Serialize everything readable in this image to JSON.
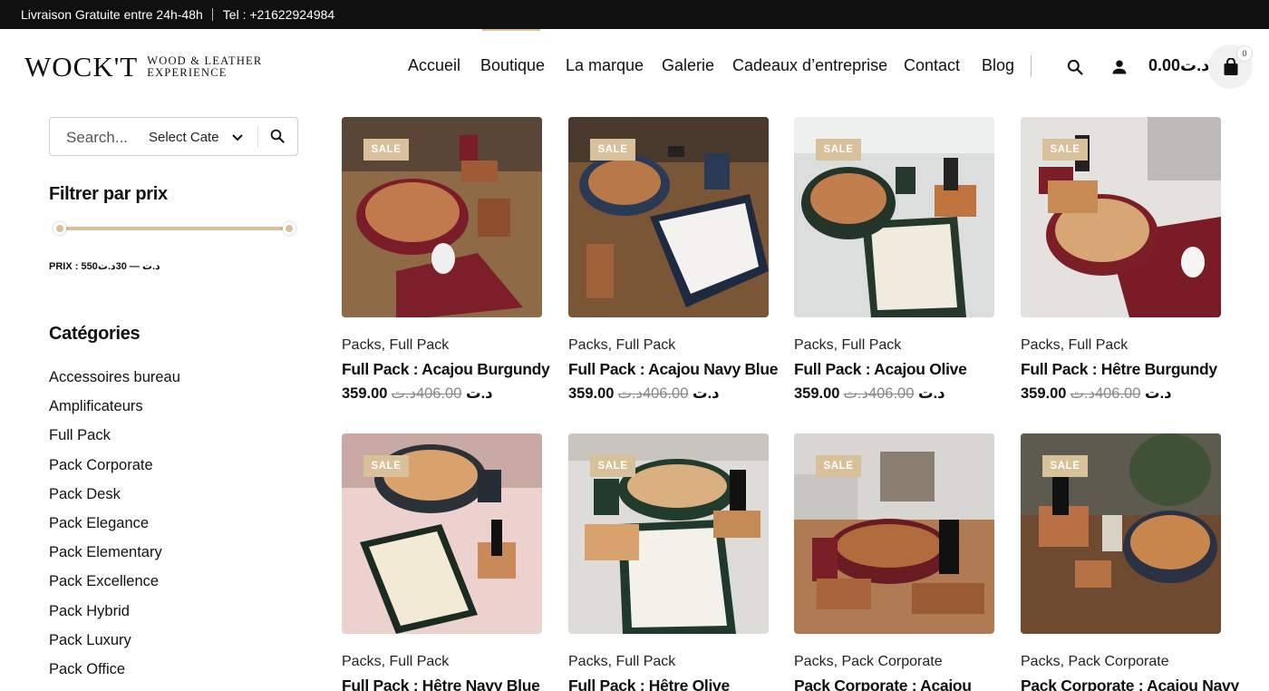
{
  "topbar": {
    "delivery": "Livraison Gratuite entre 24h-48h",
    "phone": "Tel : +21622924984"
  },
  "brand": {
    "name": "WOCK'T",
    "tagline_1": "WOOD & LEATHER",
    "tagline_2": "EXPERIENCE"
  },
  "nav": {
    "items": [
      "Accueil",
      "Boutique",
      "La marque",
      "Galerie",
      "Cadeaux d’entreprise",
      "Contact",
      "Blog"
    ],
    "active": "Boutique"
  },
  "header_icons": {
    "search": "search-icon",
    "account": "user-icon",
    "cart": "shopping-bag-icon"
  },
  "cart": {
    "total": "0.00د.ت",
    "count": "0"
  },
  "sidebar": {
    "search_placeholder": "Search...",
    "category_select": "Select Category",
    "filter_title": "Filtrer par prix",
    "price_label": "PRIX : 550د.ت — 30د.ت",
    "categories_title": "Catégories",
    "categories": [
      "Accessoires bureau",
      "Amplificateurs",
      "Full Pack",
      "Pack Corporate",
      "Pack Desk",
      "Pack Elegance",
      "Pack Elementary",
      "Pack Excellence",
      "Pack Hybrid",
      "Pack Luxury",
      "Pack Office"
    ]
  },
  "colors": {
    "accent": "#d8c09a",
    "topbar": "#101010"
  },
  "products": [
    {
      "sale": "SALE",
      "meta": "Packs, Full Pack",
      "name": "Full Pack : Acajou Burgundy",
      "price": "359.00د.ت",
      "old_price": "406.00د.ت"
    },
    {
      "sale": "SALE",
      "meta": "Packs, Full Pack",
      "name": "Full Pack : Acajou Navy Blue",
      "price": "359.00د.ت",
      "old_price": "406.00د.ت"
    },
    {
      "sale": "SALE",
      "meta": "Packs, Full Pack",
      "name": "Full Pack : Acajou Olive",
      "price": "359.00د.ت",
      "old_price": "406.00د.ت"
    },
    {
      "sale": "SALE",
      "meta": "Packs, Full Pack",
      "name": "Full Pack : Hêtre Burgundy",
      "price": "359.00د.ت",
      "old_price": "406.00د.ت"
    },
    {
      "sale": "SALE",
      "meta": "Packs, Full Pack",
      "name": "Full Pack : Hêtre Navy Blue"
    },
    {
      "sale": "SALE",
      "meta": "Packs, Full Pack",
      "name": "Full Pack : Hêtre Olive"
    },
    {
      "sale": "SALE",
      "meta": "Packs, Pack Corporate",
      "name": "Pack Corporate : Acajou"
    },
    {
      "sale": "SALE",
      "meta": "Packs, Pack Corporate",
      "name": "Pack Corporate : Acajou Navy"
    }
  ]
}
